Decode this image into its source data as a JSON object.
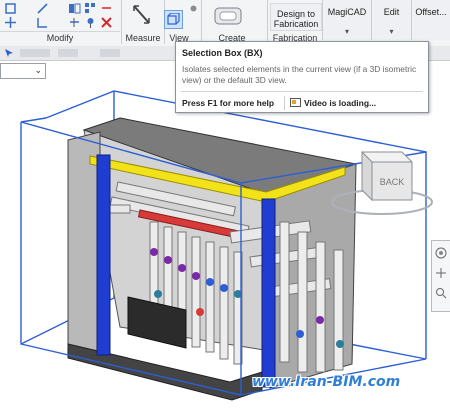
{
  "ribbon": {
    "panels": {
      "modify": "Modify",
      "measure": "Measure",
      "view": "View",
      "create": "Create",
      "fabrication": "Fabrication"
    },
    "design_to_fabrication": "Design to Fabrication",
    "tabs": [
      "MagiCAD",
      "Edit",
      "Offset..."
    ]
  },
  "view_dropdown": {
    "value": ""
  },
  "tooltip": {
    "title": "Selection Box (BX)",
    "description": "Isolates selected elements in the current view (if a 3D isometric view) or the default 3D view.",
    "help": "Press F1 for more help",
    "video": "Video is loading..."
  },
  "viewcube": {
    "face_label": "BACK"
  },
  "watermark": "www.Iran-BIM.com",
  "colors": {
    "section_box": "#2c5fd6",
    "beam_yellow": "#f2e21a",
    "column_blue": "#1f3ed1",
    "pipe_red": "#d83a3a",
    "valve_purple": "#7a2aa8"
  }
}
